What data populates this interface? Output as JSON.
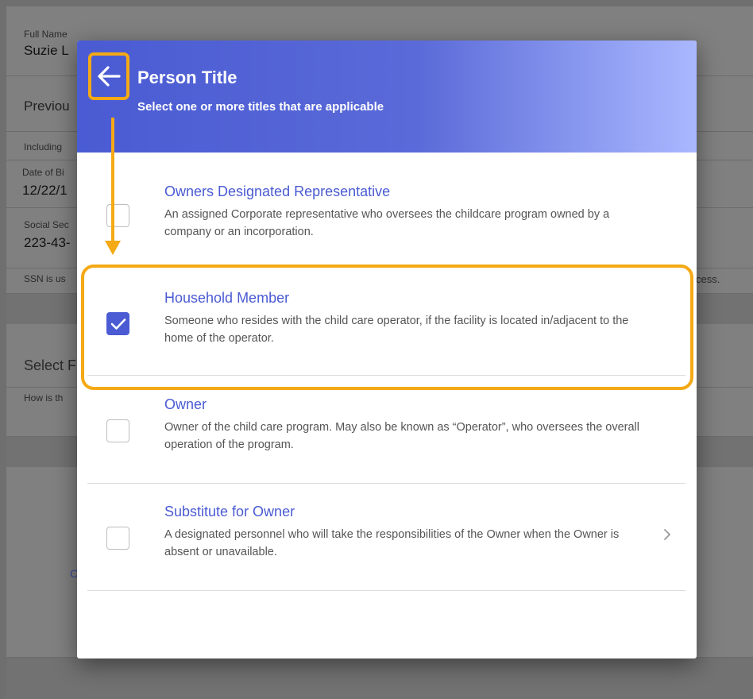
{
  "background": {
    "full_name_label": "Full Name",
    "full_name_value": "Suzie L",
    "previous_label": "Previou",
    "including_text": "Including",
    "dob_label": "Date of Bi",
    "dob_value": "12/22/1",
    "ssn_label": "Social Sec",
    "ssn_value": "223-43-",
    "ssn_note_left": "SSN is us",
    "ssn_note_right": "cess.",
    "select_label": "Select F",
    "how_text": "How is th",
    "partial_link": "C"
  },
  "modal": {
    "title": "Person Title",
    "subtitle": "Select one or more titles that are applicable",
    "options": [
      {
        "title": "Owners Designated Representative",
        "description": "An assigned Corporate representative who oversees the childcare program owned by a company or an incorporation.",
        "checked": false
      },
      {
        "title": "Household Member",
        "description": "Someone who resides with the child care operator, if the facility is located in/adjacent to the home of the operator.",
        "checked": true
      },
      {
        "title": "Owner",
        "description": "Owner of the child care program. May also be known as “Operator”, who oversees the overall operation of the program.",
        "checked": false
      },
      {
        "title": "Substitute for Owner",
        "description": "A designated personnel who will take the responsibilities of the Owner when the Owner is absent or unavailable.",
        "checked": false
      }
    ]
  },
  "colors": {
    "accent": "#4a5bd3",
    "highlight": "#f4a915"
  },
  "icons": {
    "back": "arrow-left-icon",
    "check": "checkmark-icon",
    "chevron": "chevron-right-icon"
  }
}
